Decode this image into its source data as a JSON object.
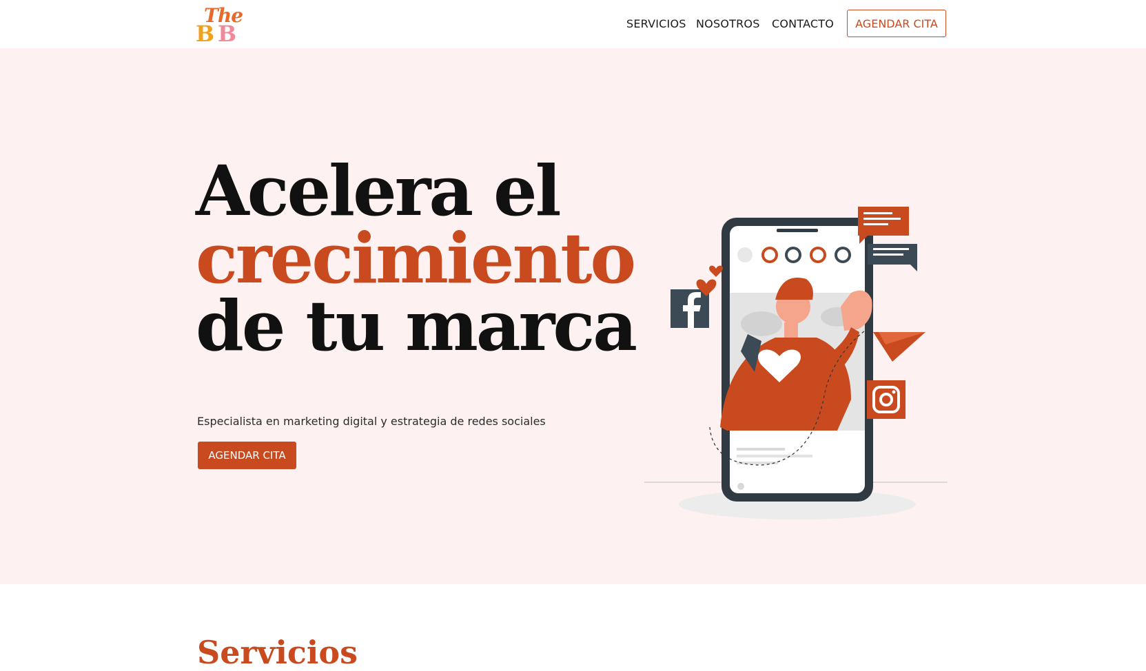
{
  "brand": {
    "logo_top": "The",
    "logo_b1": "B",
    "logo_b2": "B"
  },
  "nav": {
    "items": [
      "SERVICIOS",
      "NOSOTROS",
      "CONTACTO"
    ],
    "cta": "AGENDAR CITA"
  },
  "hero": {
    "headline_line1": "Acelera el",
    "headline_line2": "crecimiento",
    "headline_line3": "de tu marca",
    "subtitle": "Especialista en marketing digital y estrategia de redes sociales",
    "cta": "AGENDAR CITA"
  },
  "sections": {
    "services_title": "Servicios"
  },
  "colors": {
    "accent": "#c94a1f",
    "hero_bg": "#fdf2f1",
    "dark_slate": "#3c4a55"
  },
  "illustration": {
    "icons": [
      "facebook-icon",
      "instagram-icon",
      "paper-plane-icon",
      "chat-bubble-icon",
      "heart-icon"
    ]
  }
}
